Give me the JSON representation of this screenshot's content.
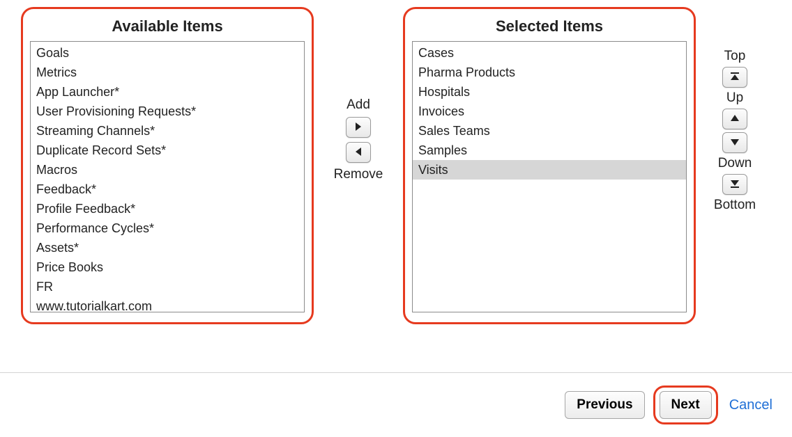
{
  "labels": {
    "available_title": "Available Items",
    "selected_title": "Selected Items",
    "add": "Add",
    "remove": "Remove",
    "top": "Top",
    "up": "Up",
    "down": "Down",
    "bottom": "Bottom",
    "previous": "Previous",
    "next": "Next",
    "cancel": "Cancel"
  },
  "available": {
    "items": [
      "Goals",
      "Metrics",
      "App Launcher*",
      "User Provisioning Requests*",
      "Streaming Channels*",
      "Duplicate Record Sets*",
      "Macros",
      "Feedback*",
      "Profile Feedback*",
      "Performance Cycles*",
      "Assets*",
      "Price Books",
      "FR",
      "www.tutorialkart.com"
    ]
  },
  "selected": {
    "items": [
      "Cases",
      "Pharma Products",
      "Hospitals",
      "Invoices",
      "Sales Teams",
      "Samples",
      "Visits"
    ],
    "highlighted_index": 6
  }
}
